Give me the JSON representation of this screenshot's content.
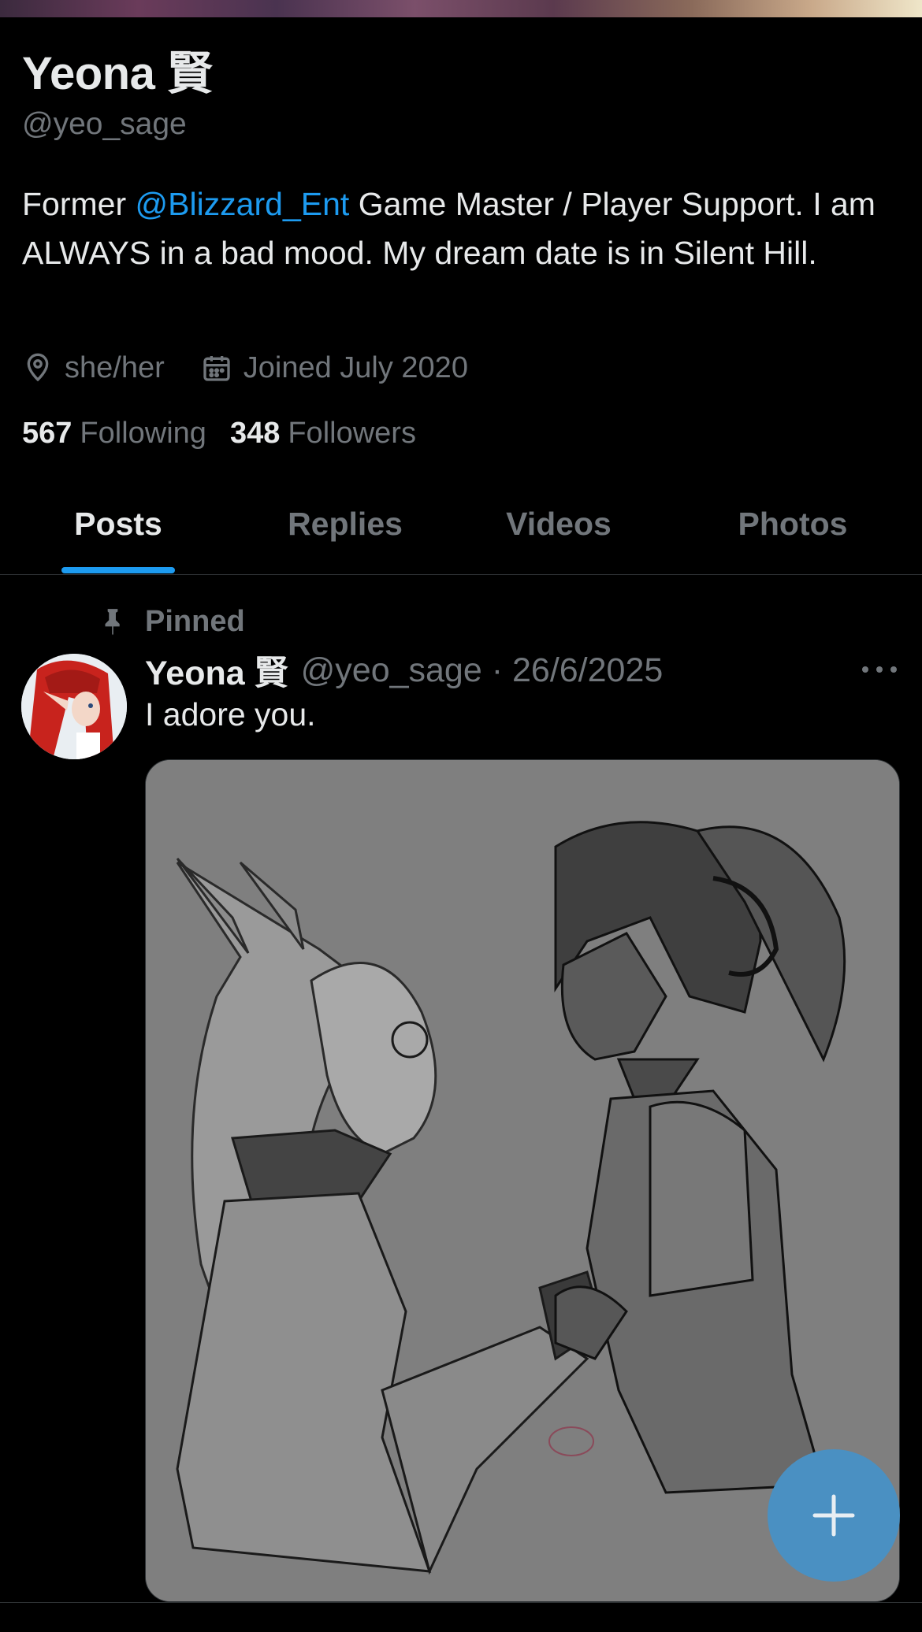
{
  "profile": {
    "name": "Yeona 賢",
    "handle": "@yeo_sage",
    "bio_prefix": "Former ",
    "bio_mention": "@Blizzard_Ent",
    "bio_suffix": " Game Master / Player Support. I am ALWAYS in a bad mood. My dream date is in Silent Hill.",
    "pronouns": "she/her",
    "joined": "Joined July 2020",
    "following_count": "567",
    "following_label": "Following",
    "followers_count": "348",
    "followers_label": "Followers"
  },
  "tabs": [
    {
      "label": "Posts",
      "active": true
    },
    {
      "label": "Replies",
      "active": false
    },
    {
      "label": "Videos",
      "active": false
    },
    {
      "label": "Photos",
      "active": false
    }
  ],
  "post": {
    "pinned_label": "Pinned",
    "author_name": "Yeona 賢",
    "author_handle": "@yeo_sage",
    "date": "26/6/2025",
    "text": "I adore you."
  },
  "colors": {
    "background": "#000000",
    "accent": "#1d9bf0",
    "muted": "#71767b",
    "text": "#e7e9ea",
    "fab": "#4a90c2"
  },
  "icons": {
    "location": "location-pin-icon",
    "calendar": "calendar-icon",
    "pin": "pin-icon",
    "more": "more-icon",
    "compose": "plus-icon"
  }
}
